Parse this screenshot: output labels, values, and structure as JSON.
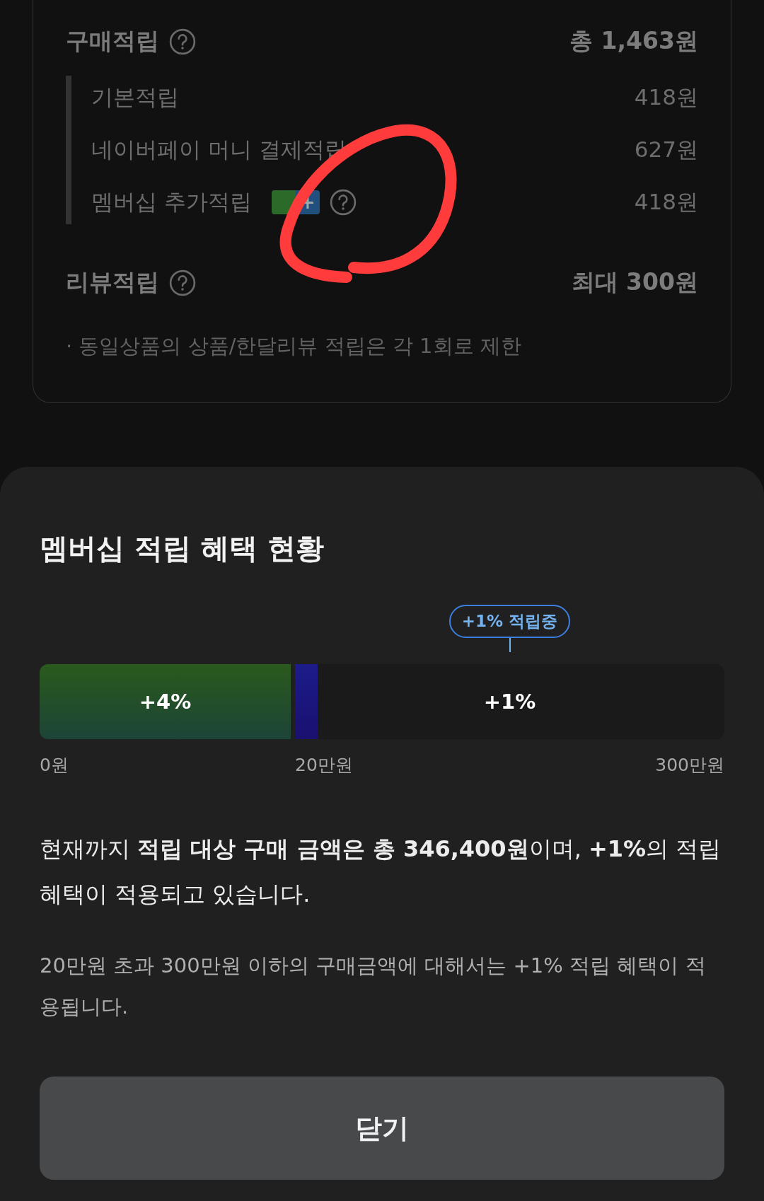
{
  "points_card": {
    "purchase": {
      "label": "구매적립",
      "amount": "총 1,463원",
      "items": [
        {
          "kind": "plain",
          "label": "기본적립",
          "amount": "418원"
        },
        {
          "kind": "plain",
          "label": "네이버페이 머니 결제적립",
          "amount": "627원"
        },
        {
          "kind": "membership",
          "label": "멤버십 추가적립",
          "badge": "+",
          "amount": "418원"
        }
      ]
    },
    "review": {
      "label": "리뷰적립",
      "amount": "최대 300원"
    },
    "note": "· 동일상품의 상품/한달리뷰 적립은 각 1회로 제한"
  },
  "sheet": {
    "title": "멤버십 적립 혜택 현황",
    "current_badge": "+1% 적립중",
    "segments": [
      {
        "label": "+4%",
        "color": "#2a5a1c"
      },
      {
        "label": "+1%",
        "level": 0.052,
        "color": "#1c1c8a"
      }
    ],
    "ticks": [
      "0원",
      "20만원",
      "300만원"
    ],
    "summary": "현재까지 **적립 대상 구매 금액은 총 346,400원**이며, **+1%**의 적립 혜택이 적용되고 있습니다.",
    "detail": "20만원 초과 300만원 이하의 구매금액에 대해서는 +1% 적립 혜택이 적용됩니다.",
    "close_button": "닫기"
  }
}
